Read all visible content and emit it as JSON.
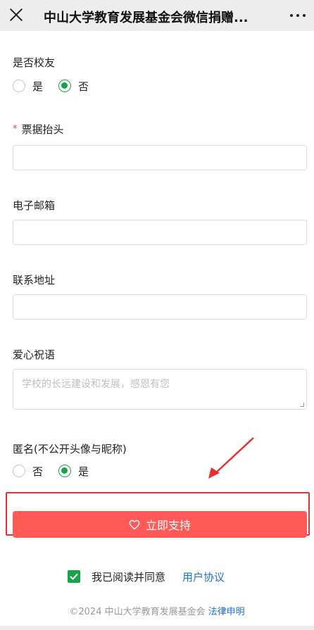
{
  "nav": {
    "title": "中山大学教育发展基金会微信捐赠...",
    "close_icon": "close-icon",
    "more_icon": "more-dots-icon"
  },
  "form": {
    "alumni": {
      "label": "是否校友",
      "options": [
        "是",
        "否"
      ],
      "selected": "否"
    },
    "invoice_title": {
      "required_mark": "*",
      "label": "票据抬头",
      "value": ""
    },
    "email": {
      "label": "电子邮箱",
      "value": ""
    },
    "address": {
      "label": "联系地址",
      "value": ""
    },
    "message": {
      "label": "爱心祝语",
      "placeholder": "学校的长远建设和发展，感恩有您"
    },
    "anonymous": {
      "label": "匿名(不公开头像与昵称)",
      "options": [
        "否",
        "是"
      ],
      "selected": "是"
    }
  },
  "support_button": {
    "label": "立即支持",
    "icon": "heart-icon"
  },
  "agreement": {
    "checked": true,
    "text": "我已阅读并同意",
    "link": "用户协议"
  },
  "footer": {
    "copyright": "©2024 中山大学教育发展基金会",
    "legal_link": "法律申明"
  },
  "colors": {
    "accent_green": "#16a34a",
    "button_red": "#ff5a57",
    "link_blue": "#1e6fd9",
    "highlight_red": "#e5322d"
  }
}
